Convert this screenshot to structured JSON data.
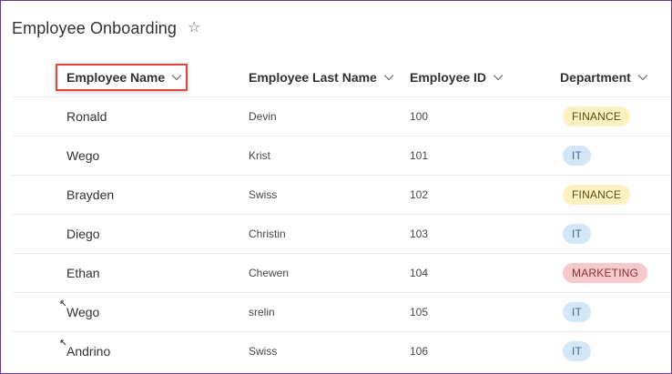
{
  "page": {
    "title": "Employee Onboarding",
    "favorite_icon": "star-outline-icon"
  },
  "columns": [
    {
      "label": "Employee Name",
      "icon": "chevron-down-icon",
      "highlighted": true
    },
    {
      "label": "Employee Last Name",
      "icon": "chevron-down-icon"
    },
    {
      "label": "Employee ID",
      "icon": "chevron-down-icon"
    },
    {
      "label": "Department",
      "icon": "chevron-down-icon"
    }
  ],
  "rows": [
    {
      "name": "Ronald",
      "last_name": "Devin",
      "id": "100",
      "department": "FINANCE",
      "is_new": false
    },
    {
      "name": "Wego",
      "last_name": "Krist",
      "id": "101",
      "department": "IT",
      "is_new": false
    },
    {
      "name": "Brayden",
      "last_name": "Swiss",
      "id": "102",
      "department": "FINANCE",
      "is_new": false
    },
    {
      "name": "Diego",
      "last_name": "Christin",
      "id": "103",
      "department": "IT",
      "is_new": false
    },
    {
      "name": "Ethan",
      "last_name": "Chewen",
      "id": "104",
      "department": "MARKETING",
      "is_new": false
    },
    {
      "name": "Wego",
      "last_name": "srelin",
      "id": "105",
      "department": "IT",
      "is_new": true
    },
    {
      "name": "Andrino",
      "last_name": "Swiss",
      "id": "106",
      "department": "IT",
      "is_new": true
    }
  ],
  "department_colors": {
    "FINANCE": {
      "bg": "#fdf0c2",
      "fg": "#5c4a12"
    },
    "IT": {
      "bg": "#d4e7f6",
      "fg": "#3a6b94"
    },
    "MARKETING": {
      "bg": "#f6c9cd",
      "fg": "#8a2f38"
    }
  },
  "colors": {
    "highlight_border": "#e0463d",
    "frame_border": "#6b3a8e"
  }
}
